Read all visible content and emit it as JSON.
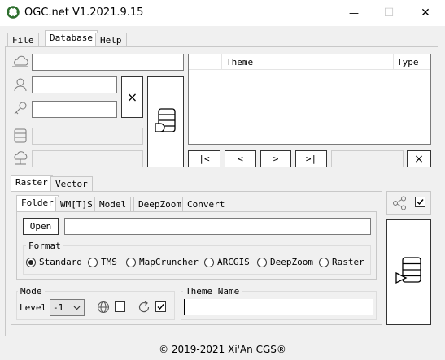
{
  "window": {
    "title": "OGC.net V1.2021.9.15",
    "minimize_glyph": "—",
    "maximize_glyph": "☐",
    "close_glyph": "✕"
  },
  "menu": {
    "tabs": [
      "File",
      "Database",
      "Help"
    ],
    "selected": "Database"
  },
  "database": {
    "server_value": "",
    "user_value": "",
    "password_value": "",
    "clear_label": "×",
    "theme_table": {
      "columns": [
        "Theme",
        "Type"
      ],
      "rows": []
    },
    "nav": {
      "first": "|<",
      "prev": "<",
      "next": ">",
      "last": ">|",
      "page_value": "",
      "clear": "×"
    }
  },
  "source_tabs": {
    "items": [
      "Raster",
      "Vector"
    ],
    "selected": "Raster"
  },
  "raster_tabs": {
    "items": [
      "Folder",
      "WM[T]S",
      "Model",
      "DeepZoom",
      "Convert"
    ],
    "selected": "Folder"
  },
  "folder": {
    "open_label": "Open",
    "path_value": ""
  },
  "format": {
    "label": "Format",
    "options": [
      "Standard",
      "TMS",
      "MapCruncher",
      "ARCGIS",
      "DeepZoom",
      "Raster"
    ],
    "selected": "Standard"
  },
  "mode": {
    "label": "Mode",
    "level_label": "Level",
    "level_value": "-1",
    "globe_checked": false,
    "refresh_checked": true
  },
  "theme_name": {
    "label": "Theme Name",
    "value": ""
  },
  "share_checked": true,
  "footer": {
    "text": "© 2019-2021 Xi'An CGS®"
  },
  "colors": {
    "accent": "#2f6f2f",
    "border": "#7a7a7a"
  }
}
